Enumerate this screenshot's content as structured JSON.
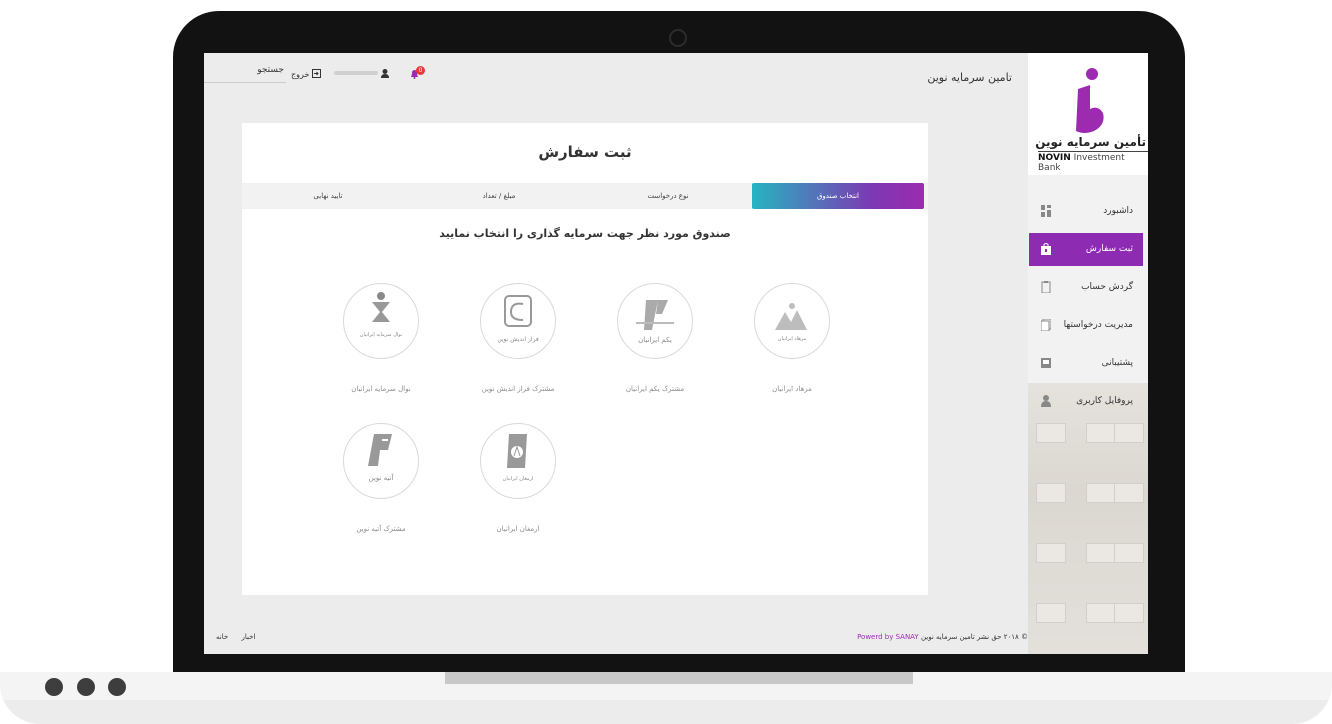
{
  "app": {
    "title": "تامین سرمایه نوین"
  },
  "logo": {
    "fa_text": "تأمین سرمایه نوین",
    "en_bold": "NOVIN",
    "en_rest": "Investment Bank"
  },
  "sidebar": {
    "items": [
      {
        "label": "داشبورد",
        "icon": "dashboard-icon"
      },
      {
        "label": "ثبت سفارش",
        "icon": "shopping-bag-icon",
        "active": true
      },
      {
        "label": "گردش حساب",
        "icon": "clipboard-icon"
      },
      {
        "label": "مدیریت درخواستها",
        "icon": "documents-icon"
      },
      {
        "label": "پشتیبانی",
        "icon": "support-icon"
      },
      {
        "label": "پروفایل کاربری",
        "icon": "user-icon"
      }
    ]
  },
  "header": {
    "search_label": "جستجو",
    "logout_label": "خروج",
    "notification_count": "0"
  },
  "card": {
    "title": "ثبت سفارش",
    "steps": [
      "انتخاب صندوق",
      "نوع درخواست",
      "مبلغ / تعداد",
      "تایید نهایی"
    ],
    "subtitle": "صندوق مورد نظر جهت سرمایه گذاری را انتخاب نمایید",
    "funds": [
      {
        "label": "مرهاد ایرانیان",
        "logo_text": "مرهاد ایرانیان"
      },
      {
        "label": "مشترک یکم ایرانیان",
        "logo_text": "یکم ایرانیان"
      },
      {
        "label": "مشترک فراز اندیش نوین",
        "logo_text": "فراز اندیش نوین"
      },
      {
        "label": "نوال سرمایه ایرانیان",
        "logo_text": "نوال سرمایه ایرانیان"
      },
      {
        "label": "ارمغان ایرانیان",
        "logo_text": "ارمغان ایرانیان"
      },
      {
        "label": "مشترک آتیه نوین",
        "logo_text": "آتیه نوین"
      }
    ]
  },
  "footer": {
    "links": [
      "خانه",
      "اخبار"
    ],
    "copyright": "© ۲۰۱۸ حق نشر تامین سرمایه نوین",
    "powered": "Powerd by SANAY"
  },
  "colors": {
    "accent": "#9c2bb0",
    "gradient_start": "#26b5c0",
    "badge": "#e53935"
  }
}
